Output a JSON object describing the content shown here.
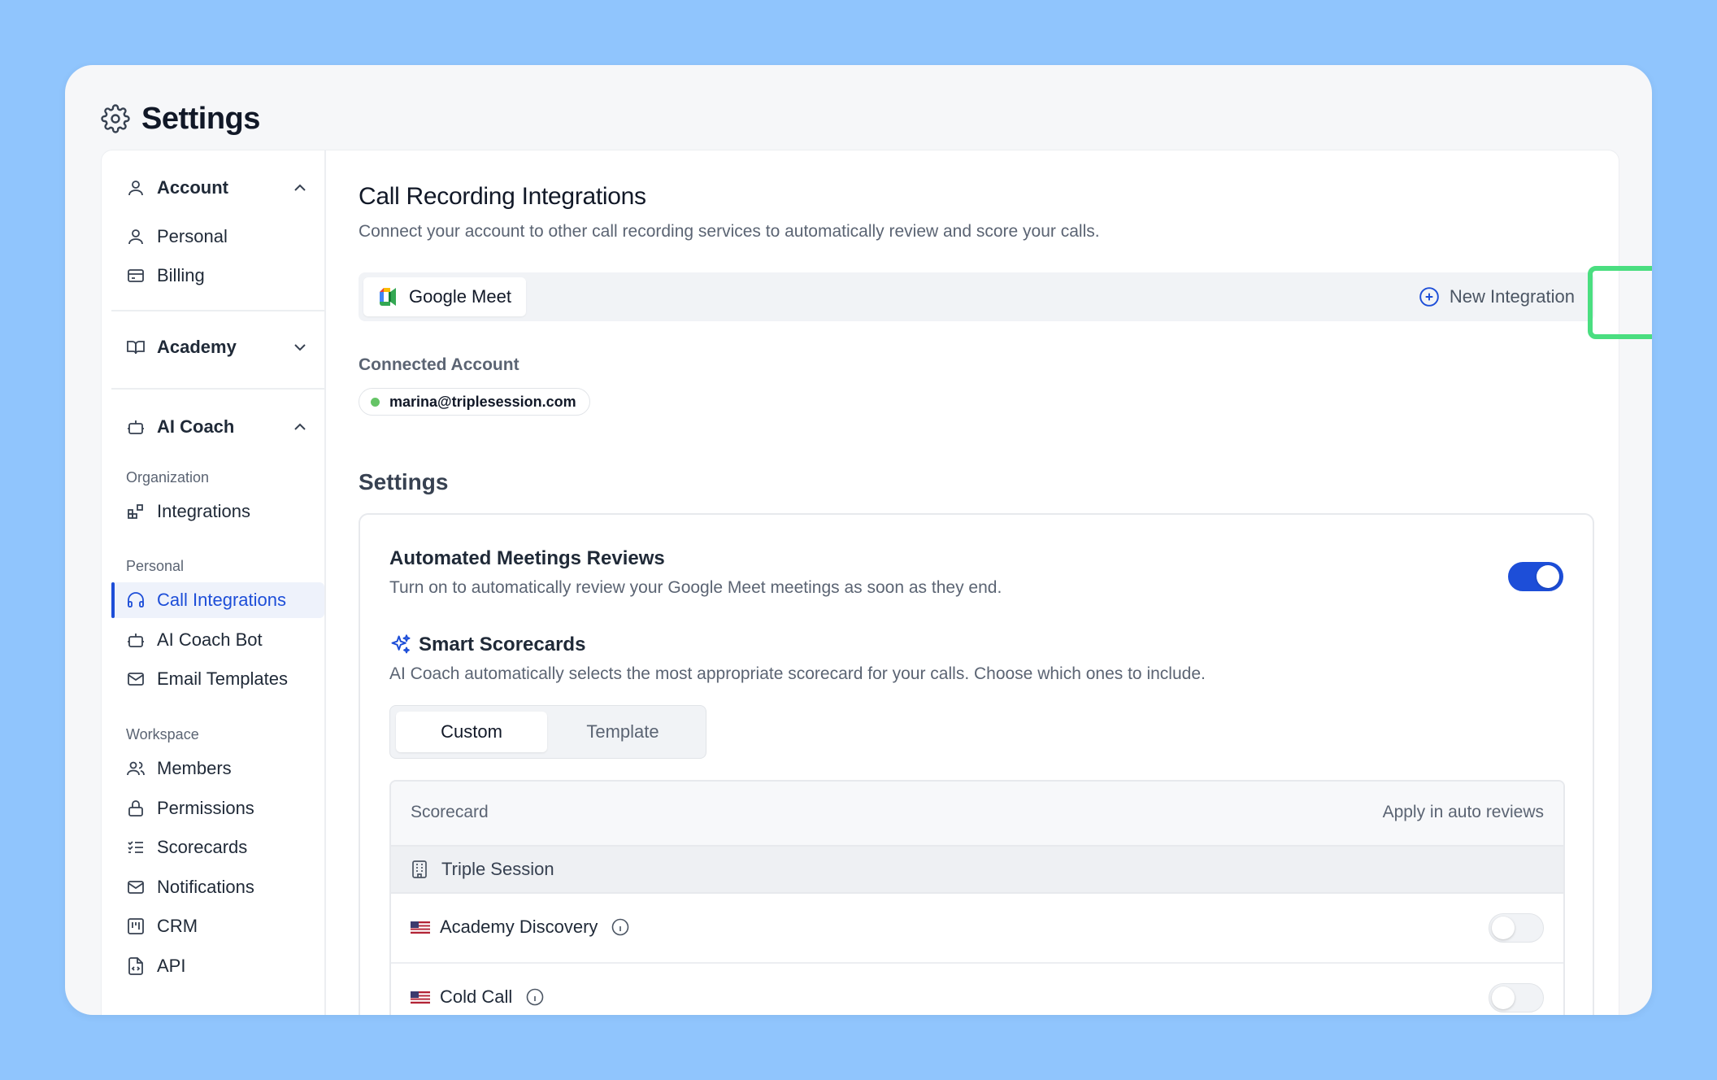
{
  "page": {
    "title": "Settings"
  },
  "sidebar": {
    "account": {
      "label": "Account",
      "items": [
        {
          "label": "Personal"
        },
        {
          "label": "Billing"
        }
      ]
    },
    "academy": {
      "label": "Academy"
    },
    "ai_coach": {
      "label": "AI Coach",
      "sections": {
        "organization": "Organization",
        "personal": "Personal",
        "workspace": "Workspace"
      },
      "organization_items": [
        {
          "label": "Integrations"
        }
      ],
      "personal_items": [
        {
          "label": "Call Integrations"
        },
        {
          "label": "AI Coach Bot"
        },
        {
          "label": "Email Templates"
        }
      ],
      "workspace_items": [
        {
          "label": "Members"
        },
        {
          "label": "Permissions"
        },
        {
          "label": "Scorecards"
        },
        {
          "label": "Notifications"
        },
        {
          "label": "CRM"
        },
        {
          "label": "API"
        }
      ]
    }
  },
  "main": {
    "title": "Call Recording Integrations",
    "subtitle": "Connect your account to other call recording services to automatically review and score your calls.",
    "integration_tab": "Google Meet",
    "new_integration_label": "New Integration",
    "connected_account_label": "Connected Account",
    "connected_account_email": "marina@triplesession.com",
    "settings_heading": "Settings",
    "automated_reviews": {
      "title": "Automated Meetings Reviews",
      "description": "Turn on to automatically review your Google Meet meetings as soon as they end.",
      "enabled": true
    },
    "smart_scorecards": {
      "title": "Smart Scorecards",
      "description": "AI Coach automatically selects the most appropriate scorecard for your calls. Choose which ones to include.",
      "tabs": [
        "Custom",
        "Template"
      ],
      "selected_tab": "Custom"
    },
    "table": {
      "col_scorecard": "Scorecard",
      "col_apply": "Apply in auto reviews",
      "group": "Triple Session",
      "rows": [
        {
          "name": "Academy Discovery",
          "enabled": false
        },
        {
          "name": "Cold Call",
          "enabled": false
        }
      ]
    }
  },
  "colors": {
    "background": "#90c5fd",
    "accent": "#1d4ed8",
    "highlight": "#4ade80",
    "status_dot": "#65c466"
  }
}
